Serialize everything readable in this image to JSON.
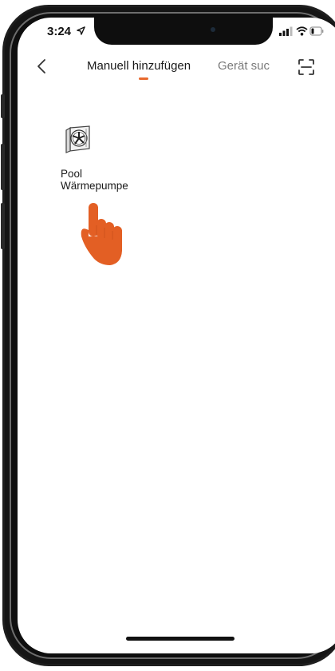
{
  "status_bar": {
    "time": "3:24",
    "icons": [
      "location-arrow-icon",
      "signal-icon",
      "wifi-icon",
      "battery-icon"
    ]
  },
  "nav": {
    "back_icon": "chevron-left-icon",
    "tabs": [
      {
        "label": "Manuell hinzufügen",
        "active": true
      },
      {
        "label": "Gerät suc",
        "active": false
      }
    ],
    "scan_icon": "scan-frame-icon"
  },
  "devices": [
    {
      "icon": "heat-pump-fan-icon",
      "label_line1": "Pool",
      "label_line2": "Wärmepumpe"
    }
  ],
  "overlay": {
    "icon": "pointing-hand-icon"
  },
  "colors": {
    "accent": "#e8692e",
    "text_primary": "#1a1a1a",
    "text_secondary": "#7a7a7a",
    "background": "#ffffff",
    "frame": "#151515"
  }
}
